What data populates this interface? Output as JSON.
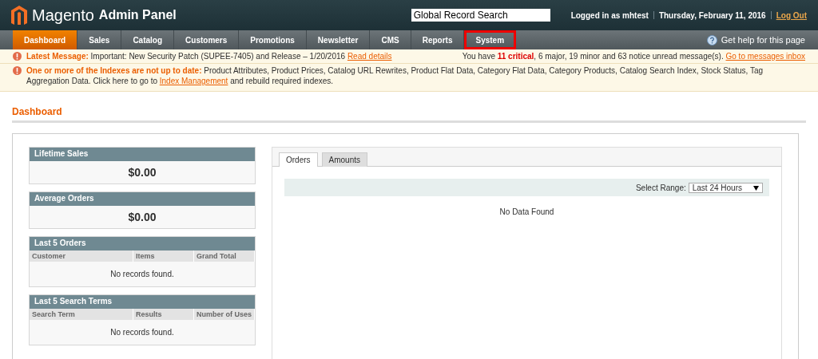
{
  "header": {
    "logo_text": "Magento",
    "subtitle": "Admin Panel",
    "search": {
      "value": "Global Record Search"
    },
    "user": "Logged in as mhtest",
    "date": "Thursday, February 11, 2016",
    "logout": "Log Out"
  },
  "nav": {
    "items": [
      {
        "label": "Dashboard",
        "selected": true,
        "highlighted": false
      },
      {
        "label": "Sales",
        "selected": false,
        "highlighted": false
      },
      {
        "label": "Catalog",
        "selected": false,
        "highlighted": false
      },
      {
        "label": "Customers",
        "selected": false,
        "highlighted": false
      },
      {
        "label": "Promotions",
        "selected": false,
        "highlighted": false
      },
      {
        "label": "Newsletter",
        "selected": false,
        "highlighted": false
      },
      {
        "label": "CMS",
        "selected": false,
        "highlighted": false
      },
      {
        "label": "Reports",
        "selected": false,
        "highlighted": false
      },
      {
        "label": "System",
        "selected": false,
        "highlighted": true
      }
    ],
    "help": "Get help for this page"
  },
  "messages": [
    {
      "text": "**Latest Message:** Important: New Security Patch (SUPEE-7405) and Release – 1/20/2016",
      "link": "Read details",
      "summary": "You have **11 critical**, 6 major, 19 minor and 63 notice unread message(s).",
      "summary_link": "Go to messages inbox"
    },
    {
      "text": "**One or more of the Indexes are not up to date:** Product Attributes, Product Prices, Catalog URL Rewrites, Product Flat Data, Category Flat Data, Category Products, Catalog Search Index, Stock Status, Tag Aggregation Data. Click here to go to",
      "link": "Index Management",
      "tail": "and rebuild required indexes."
    }
  ],
  "page_title": "Dashboard",
  "stats": [
    {
      "title": "Lifetime Sales",
      "value": "$0.00"
    },
    {
      "title": "Average Orders",
      "value": "$0.00"
    }
  ],
  "grids": [
    {
      "title": "Last 5 Orders",
      "columns": [
        "Customer",
        "Items",
        "Grand Total"
      ],
      "empty": "No records found."
    },
    {
      "title": "Last 5 Search Terms",
      "columns": [
        "Search Term",
        "Results",
        "Number of Uses"
      ],
      "empty": "No records found."
    }
  ],
  "chart_panel": {
    "tabs": [
      {
        "label": "Orders",
        "selected": true
      },
      {
        "label": "Amounts",
        "selected": false
      }
    ],
    "range_label": "Select Range:",
    "range_value": "Last 24 Hours",
    "empty": "No Data Found"
  }
}
